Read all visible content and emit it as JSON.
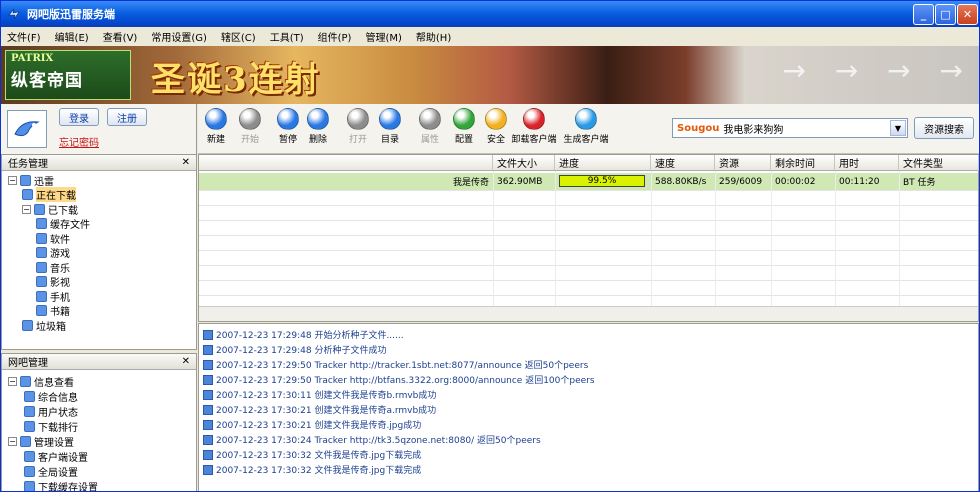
{
  "window": {
    "title": "网吧版迅雷服务端",
    "min_label": "_",
    "max_label": "□",
    "close_label": "✕"
  },
  "menu": [
    "文件(F)",
    "编辑(E)",
    "查看(V)",
    "常用设置(G)",
    "辖区(C)",
    "工具(T)",
    "组件(P)",
    "管理(M)",
    "帮助(H)"
  ],
  "banner": {
    "logo_top": "PATRIX",
    "logo_main": "纵客帝国",
    "slogan": "圣诞3连射",
    "arrows": "→ → → →"
  },
  "login": {
    "login_label": "登录",
    "register_label": "注册",
    "forgot_label": "忘记密码"
  },
  "toolbar": {
    "tools": [
      {
        "label": "新建",
        "color": "#2a78e4",
        "enabled": true
      },
      {
        "label": "开始",
        "color": "#8c8c8c",
        "enabled": false
      },
      {
        "label": "暂停",
        "color": "#2a78e4",
        "enabled": true
      },
      {
        "label": "删除",
        "color": "#2a78e4",
        "enabled": true
      },
      {
        "label": "打开",
        "color": "#8c8c8c",
        "enabled": false
      },
      {
        "label": "目录",
        "color": "#2a78e4",
        "enabled": true
      },
      {
        "label": "属性",
        "color": "#8c8c8c",
        "enabled": false
      },
      {
        "label": "配置",
        "color": "#33a63a",
        "enabled": true
      },
      {
        "label": "安全",
        "color": "#f0b020",
        "enabled": true
      },
      {
        "label": "卸载客户端",
        "color": "#d9232a",
        "enabled": true
      },
      {
        "label": "生成客户端",
        "color": "#2a9ae4",
        "enabled": true
      }
    ],
    "search_brand": "Sougou",
    "search_value": "我电影来狗狗",
    "search_button": "资源搜索"
  },
  "task_panel": {
    "title": "任务管理",
    "close": "✕",
    "items": [
      {
        "label": "迅雷",
        "level": 0,
        "expander": "⊟"
      },
      {
        "label": "正在下载",
        "level": 1,
        "expander": "",
        "selected": true
      },
      {
        "label": "已下载",
        "level": 1,
        "expander": "⊟"
      },
      {
        "label": "缓存文件",
        "level": 2,
        "expander": ""
      },
      {
        "label": "软件",
        "level": 2,
        "expander": ""
      },
      {
        "label": "游戏",
        "level": 2,
        "expander": ""
      },
      {
        "label": "音乐",
        "level": 2,
        "expander": ""
      },
      {
        "label": "影视",
        "level": 2,
        "expander": ""
      },
      {
        "label": "手机",
        "level": 2,
        "expander": ""
      },
      {
        "label": "书籍",
        "level": 2,
        "expander": ""
      },
      {
        "label": "垃圾箱",
        "level": 1,
        "expander": ""
      }
    ]
  },
  "netbar_panel": {
    "title": "网吧管理",
    "close": "✕",
    "items": [
      {
        "label": "信息查看",
        "level": 0,
        "expander": "⊟"
      },
      {
        "label": "综合信息",
        "level": 1,
        "expander": ""
      },
      {
        "label": "用户状态",
        "level": 1,
        "expander": ""
      },
      {
        "label": "下载排行",
        "level": 1,
        "expander": ""
      },
      {
        "label": "管理设置",
        "level": 0,
        "expander": "⊟"
      },
      {
        "label": "客户端设置",
        "level": 1,
        "expander": ""
      },
      {
        "label": "全局设置",
        "level": 1,
        "expander": ""
      },
      {
        "label": "下载缓存设置",
        "level": 1,
        "expander": ""
      }
    ]
  },
  "grid": {
    "columns": [
      "文件大小",
      "进度",
      "速度",
      "资源",
      "剩余时间",
      "用时",
      "文件类型"
    ],
    "rows": [
      {
        "name": "我是传奇",
        "size": "362.90MB",
        "progress_label": "99.5%",
        "progress": 0.995,
        "speed": "588.80KB/s",
        "sources": "259/6009",
        "remaining": "00:00:02",
        "elapsed": "00:11:20",
        "type": "BT 任务"
      }
    ]
  },
  "log": [
    "2007-12-23 17:29:48 开始分析种子文件......",
    "2007-12-23 17:29:48 分析种子文件成功",
    "2007-12-23 17:29:50 Tracker http://tracker.1sbt.net:8077/announce 返回50个peers",
    "2007-12-23 17:29:50 Tracker http://btfans.3322.org:8000/announce 返回100个peers",
    "2007-12-23 17:30:11 创建文件我是传奇b.rmvb成功",
    "2007-12-23 17:30:21 创建文件我是传奇a.rmvb成功",
    "2007-12-23 17:30:21 创建文件我是传奇.jpg成功",
    "2007-12-23 17:30:24 Tracker http://tk3.5qzone.net:8080/ 返回50个peers",
    "2007-12-23 17:30:32 文件我是传奇.jpg下载完成",
    "2007-12-23 17:30:32 文件我是传奇.jpg下载完成"
  ]
}
